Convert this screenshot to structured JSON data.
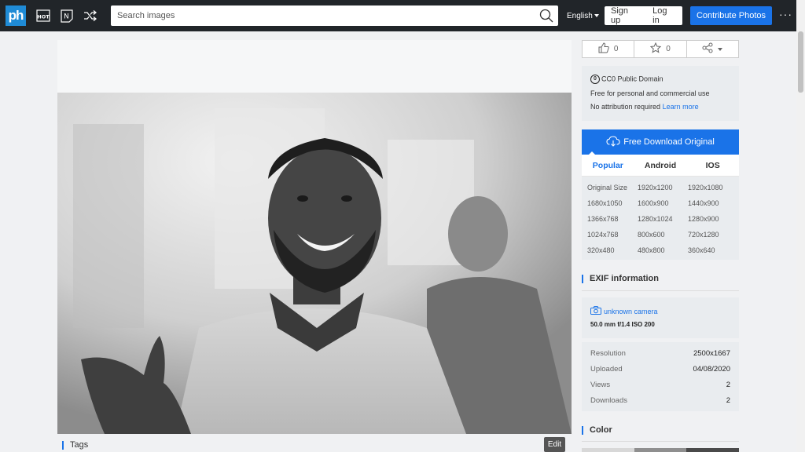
{
  "header": {
    "logo": "ph",
    "search_placeholder": "Search images",
    "language": "English",
    "signup": "Sign up",
    "login": "Log in",
    "contribute": "Contribute Photos",
    "more": "···"
  },
  "actions": {
    "likes": "0",
    "favorites": "0"
  },
  "license": {
    "name": "CC0 Public Domain",
    "line1": "Free for personal and commercial use",
    "line2": "No attribution required",
    "learn_more": "Learn more"
  },
  "download": {
    "label": "Free Download Original",
    "tabs": [
      "Popular",
      "Android",
      "IOS"
    ],
    "sizes": [
      "Original Size",
      "1920x1200",
      "1920x1080",
      "1680x1050",
      "1600x900",
      "1440x900",
      "1366x768",
      "1280x1024",
      "1280x900",
      "1024x768",
      "800x600",
      "720x1280",
      "320x480",
      "480x800",
      "360x640"
    ]
  },
  "exif": {
    "title": "EXIF information",
    "camera": "unknown camera",
    "lens": "50.0 mm f/1.4 ISO 200",
    "rows": [
      {
        "k": "Resolution",
        "v": "2500x1667"
      },
      {
        "k": "Uploaded",
        "v": "04/08/2020"
      },
      {
        "k": "Views",
        "v": "2"
      },
      {
        "k": "Downloads",
        "v": "2"
      }
    ]
  },
  "color": {
    "title": "Color",
    "swatches": [
      "#d8d8d8",
      "#8f8f8f",
      "#4a4a4a"
    ]
  },
  "tags": {
    "title": "Tags",
    "edit": "Edit"
  },
  "colors": {
    "header_bg": "#212529",
    "accent": "#1a73e8",
    "logo_bg": "#1f8bd6"
  }
}
